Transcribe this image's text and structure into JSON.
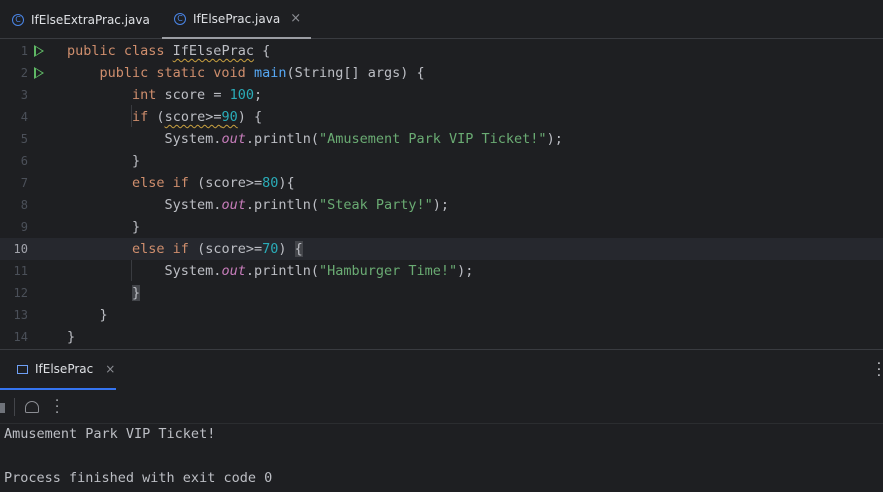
{
  "tabs": [
    {
      "label": "IfElseExtraPrac.java",
      "icon": "java-class-icon",
      "active": false
    },
    {
      "label": "IfElsePrac.java",
      "icon": "java-class-icon",
      "active": true
    }
  ],
  "close_glyph": "×",
  "editor": {
    "current_line": 10,
    "line_numbers": [
      "1",
      "2",
      "3",
      "4",
      "5",
      "6",
      "7",
      "8",
      "9",
      "10",
      "11",
      "12",
      "13",
      "14"
    ]
  },
  "run_panel": {
    "tab_label": "IfElsePrac",
    "output_lines": [
      "Amusement Park VIP Ticket!",
      "",
      "Process finished with exit code 0"
    ]
  },
  "colors": {
    "keyword": "#cf8e6d",
    "method": "#56a8f5",
    "number": "#2aacb8",
    "string": "#6aab73",
    "field": "#c77dbb",
    "run_gutter_icon": "#5fb865",
    "accent": "#3574f0"
  }
}
